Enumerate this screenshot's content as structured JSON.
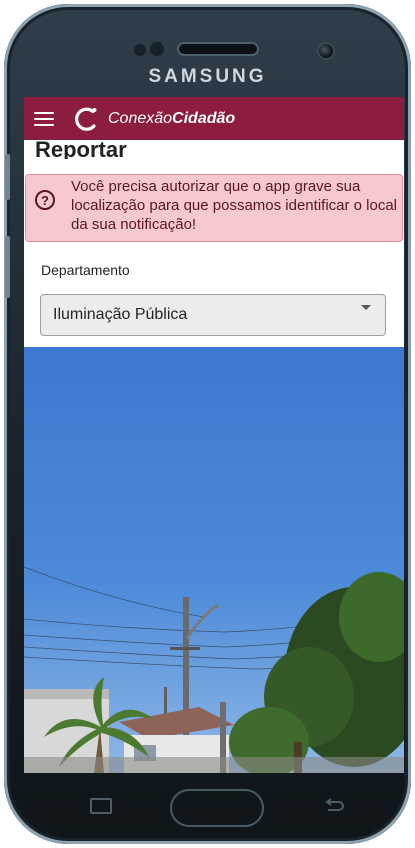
{
  "device": {
    "brand": "SAMSUNG"
  },
  "appbar": {
    "title_regular": "Conexão",
    "title_bold": "Cidadão"
  },
  "page": {
    "heading": "Reportar",
    "alert_icon": "?",
    "alert_text": "Você precisa autorizar que o app grave sua localização para que possamos identificar o local da sua notificação!"
  },
  "form": {
    "department_label": "Departamento",
    "department_value": "Iluminação Pública"
  },
  "colors": {
    "appbar": "#8c1d3e",
    "alert_bg": "#f7c9cf",
    "alert_text": "#5b1522"
  },
  "icons": {
    "menu": "hamburger-icon",
    "logo": "refresh-logo-icon",
    "alert": "question-circle-icon",
    "dropdown": "caret-down-icon",
    "recent": "recent-apps-icon",
    "back": "back-icon"
  }
}
